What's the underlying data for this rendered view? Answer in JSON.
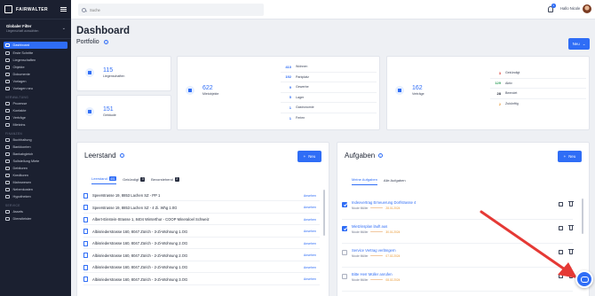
{
  "brand": {
    "name": "FAIRWALTER"
  },
  "filter": {
    "title": "Globaler Filter",
    "subtitle": "Liegenschaft auswählen"
  },
  "nav": {
    "main": [
      {
        "label": "Dashboard",
        "name": "nav-dashboard",
        "active": true
      },
      {
        "label": "Erste Schritte",
        "name": "nav-erste-schritte"
      },
      {
        "label": "Liegenschaften",
        "name": "nav-liegenschaften"
      },
      {
        "label": "Objekte",
        "name": "nav-objekte"
      },
      {
        "label": "Dokumente",
        "name": "nav-dokumente"
      },
      {
        "label": "Vorlagen",
        "name": "nav-vorlagen"
      },
      {
        "label": "Vorlagen neu",
        "name": "nav-vorlagen-neu"
      }
    ],
    "section1": "VERWALTUNG",
    "verwaltung": [
      {
        "label": "Prozesse",
        "name": "nav-prozesse"
      },
      {
        "label": "Kontakte",
        "name": "nav-kontakte"
      },
      {
        "label": "Verträge",
        "name": "nav-vertraege"
      },
      {
        "label": "Mietzins",
        "name": "nav-mietzins"
      }
    ],
    "section2": "FINANZEN",
    "finanzen": [
      {
        "label": "Buchhaltung",
        "name": "nav-buchhaltung"
      },
      {
        "label": "Bankkonten",
        "name": "nav-bankkonten"
      },
      {
        "label": "Bankabgleich",
        "name": "nav-bankabgleich"
      },
      {
        "label": "Sollstellung Miete",
        "name": "nav-sollstellung-miete"
      },
      {
        "label": "Debitoren",
        "name": "nav-debitoren"
      },
      {
        "label": "Kreditoren",
        "name": "nav-kreditoren"
      },
      {
        "label": "Mahnwesen",
        "name": "nav-mahnwesen"
      },
      {
        "label": "Nebenkosten",
        "name": "nav-nebenkosten"
      },
      {
        "label": "Hypotheken",
        "name": "nav-hypotheken"
      }
    ],
    "section3": "SERVICE",
    "service": [
      {
        "label": "Assets",
        "name": "nav-assets"
      },
      {
        "label": "Dienstleister",
        "name": "nav-dienstleister"
      }
    ]
  },
  "topbar": {
    "search_placeholder": "Suche",
    "notification_count": "1",
    "greeting": "Hallo Nicole"
  },
  "page": {
    "title": "Dashboard",
    "subtitle": "Portfolio",
    "new_button": "Neu"
  },
  "portfolio": {
    "liegenschaften": {
      "value": "115",
      "label": "Liegenschaften"
    },
    "gebaeude": {
      "value": "151",
      "label": "Gebäude"
    },
    "mietobjekte": {
      "value": "622",
      "label": "Mietobjekte",
      "breakdown": [
        {
          "value": "410",
          "label": "Wohnen"
        },
        {
          "value": "192",
          "label": "Parkplatz"
        },
        {
          "value": "9",
          "label": "Gewerbe"
        },
        {
          "value": "5",
          "label": "Lager"
        },
        {
          "value": "1",
          "label": "Gastronomie"
        },
        {
          "value": "1",
          "label": "Ferien"
        }
      ]
    },
    "vertraege": {
      "value": "162",
      "label": "Verträge",
      "breakdown": [
        {
          "value": "3",
          "label": "Gekündigt",
          "color": "#d9342b"
        },
        {
          "value": "129",
          "label": "Aktiv",
          "color": "#2f9e5a"
        },
        {
          "value": "28",
          "label": "Beendet",
          "color": "#1d2433"
        },
        {
          "value": "2",
          "label": "Zukünftig",
          "color": "#e8952e"
        }
      ]
    }
  },
  "leerstand": {
    "title": "Leerstand",
    "new_button": "Neu",
    "tabs": [
      {
        "label": "Leerstand",
        "count": "401",
        "active": true
      },
      {
        "label": "Gekündigt",
        "count": "3"
      },
      {
        "label": "Bevorstehend",
        "count": "2"
      }
    ],
    "action_label": "Ansehen",
    "rows": [
      "Speerstrasse 19, 8853 Lachen SZ - PP 1",
      "Speerstrasse 19, 8853 Lachen SZ - 4 Zi. Whg 1.0G",
      "Albert-Einstein-Strasse 1, 8404 Winterthur - COOP Mineraloel Schweiz",
      "Albisriederstrasse 160, 8047 Zürich - 3-Zi-Wohnung 1.OG",
      "Albisriederstrasse 160, 8047 Zürich - 3-Zi-Wohnung 2.OG",
      "Albisriederstrasse 160, 8047 Zürich - 2-Zi-Wohnung 2.OG",
      "Albisriederstrasse 160, 8047 Zürich - 2-Zi-Wohnung 1.OG",
      "Albisriederstrasse 160, 8047 Zürich - 3-Zi-Wohnung 3.OG"
    ]
  },
  "aufgaben": {
    "title": "Aufgaben",
    "new_button": "Neu",
    "tabs": [
      {
        "label": "Meine Aufgaben",
        "active": true
      },
      {
        "label": "Alle Aufgaben"
      }
    ],
    "tasks": [
      {
        "title": "Indexvertrag Erneuerung Dorfstrasse 4",
        "owner": "Nicole Müller",
        "date": "28.01.2024",
        "checked": true
      },
      {
        "title": "Mietzinsplan läuft aus",
        "owner": "Nicole Müller",
        "date": "30.01.2024",
        "checked": true
      },
      {
        "title": "Service Vertrag verlängern",
        "owner": "Nicole Müller",
        "date": "07.02.2024",
        "checked": false
      },
      {
        "title": "Bitte Herr Müller anrufen",
        "owner": "Nicole Müller",
        "date": "08.02.2024",
        "checked": false
      }
    ]
  },
  "colors": {
    "accent": "#2f6df6",
    "sidebar": "#1b2030",
    "arrow": "#e53935"
  }
}
